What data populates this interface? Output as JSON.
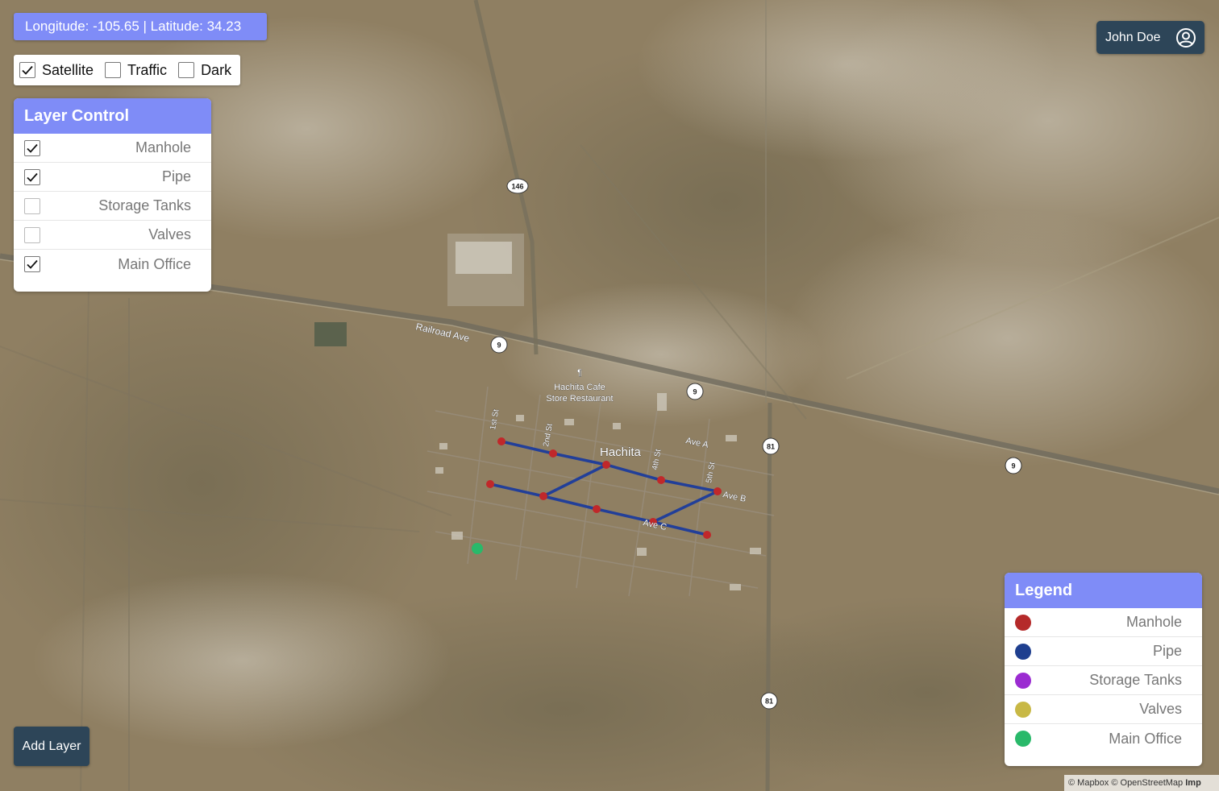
{
  "coordinates": {
    "longitude_text": "Longitude: -105.65",
    "latitude_text": " | Latitude: 34.23"
  },
  "style_toggles": [
    {
      "label": "Satellite",
      "checked": true
    },
    {
      "label": "Traffic",
      "checked": false
    },
    {
      "label": "Dark",
      "checked": false
    }
  ],
  "layer_control": {
    "title": "Layer Control",
    "layers": [
      {
        "label": "Manhole",
        "checked": true
      },
      {
        "label": "Pipe",
        "checked": true
      },
      {
        "label": "Storage Tanks",
        "checked": false
      },
      {
        "label": "Valves",
        "checked": false
      },
      {
        "label": "Main Office",
        "checked": true
      }
    ]
  },
  "legend": {
    "title": "Legend",
    "items": [
      {
        "label": "Manhole",
        "color": "#b52a2a"
      },
      {
        "label": "Pipe",
        "color": "#1f3f8f"
      },
      {
        "label": "Storage Tanks",
        "color": "#9b2bd1"
      },
      {
        "label": "Valves",
        "color": "#c8b845"
      },
      {
        "label": "Main Office",
        "color": "#29b96a"
      }
    ]
  },
  "user": {
    "name": "John Doe",
    "icon": "account-circle-icon"
  },
  "add_layer_label": "Add Layer",
  "attribution": {
    "text": "© Mapbox © OpenStreetMap ",
    "link": "Imp"
  },
  "map": {
    "town_label": "Hachita",
    "poi_label_line1": "Hachita Cafe",
    "poi_label_line2": "Store Restaurant",
    "poi_icon": "restaurant-icon",
    "streets": {
      "railroad": "Railroad Ave",
      "ave_a": "Ave A",
      "ave_b": "Ave B",
      "ave_c": "Ave C",
      "st1": "1st St",
      "st2": "2nd St",
      "st4": "4th St",
      "st5": "5th St"
    },
    "shields": {
      "r146": "146",
      "r9a": "9",
      "r9b": "9",
      "r9c": "9",
      "r81a": "81",
      "r81b": "81"
    },
    "colors": {
      "manhole": "#c0282a",
      "pipe": "#223f99",
      "main_office": "#29b96a"
    }
  }
}
